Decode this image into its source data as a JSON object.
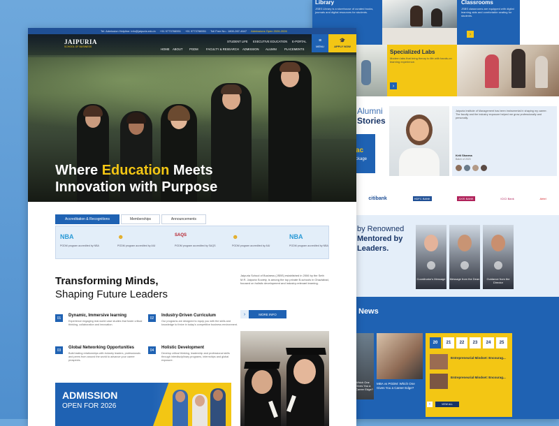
{
  "right": {
    "library": {
      "title": "Library",
      "text": "JSBS Library is a storehouse of curated books, journals and digital resources for students."
    },
    "classrooms": {
      "title": "Classrooms",
      "text": "JSBS classrooms are equipped with digital learning aids and comfortable seating for students."
    },
    "labs": {
      "title": "Specialized Labs",
      "text": "Modern labs that bring theory to life with hands-on learning experience."
    },
    "alumni": {
      "heading1": "Alumni",
      "heading2": "Stories",
      "card_partial": "ac",
      "card_partial2": "ckage",
      "quote": "Jaipuria Institute of Management has been instrumental in shaping my career. The faculty and the industry exposure helped me grow professionally and personally.",
      "name": "Kriti Sharma",
      "role": "Batch of 2023"
    },
    "recruiters": [
      "citibank",
      "HDFC BANK",
      "AXIS BANK",
      "ICICI Bank",
      "Airtel"
    ],
    "mentored": {
      "l1": "by Renowned",
      "l2": "Mentored by",
      "l3": "Leaders.",
      "p1": {
        "caption": "Coordinator's Message"
      },
      "p2": {
        "caption": "Message from the Dean"
      },
      "p3": {
        "caption": "Guidance from the Director"
      }
    },
    "news": {
      "heading": "News",
      "n1": "MBA vs PGDM: Which One Gives You a Career Edge?",
      "n0": "Which One Gives You a Career Edge?",
      "dates": [
        "20",
        "21",
        "22",
        "23",
        "24",
        "25"
      ],
      "month": "May",
      "items": [
        "Entrepreneurial Mindset: Encourag...",
        "Entrepreneurial Mindset: Encourag..."
      ],
      "view_all": "VIEW ALL"
    }
  },
  "left": {
    "topbar": [
      "Tel: Admission Helpline: info@jaipuria.edu.in",
      "+91 9773766551",
      "+91 9773766551",
      "Toll Free No.: 1800-267-4647",
      "Admissions Open 2026-2026"
    ],
    "brand": {
      "name": "JAIPURIA",
      "sub": "SCHOOL OF BUSINESS"
    },
    "utility_nav": [
      "STUDENT LIFE",
      "EXECUTIVE EDUCATION",
      "E-PORTAL"
    ],
    "main_nav": [
      "HOME",
      "ABOUT",
      "PGDM",
      "FACULTY & RESEARCH",
      "ADMISSION",
      "ALUMNI",
      "PLACEMENTS"
    ],
    "menu_label": "MENU",
    "apply_label": "APPLY NOW",
    "hero": {
      "title_before": "Where ",
      "title_highlight": "Education",
      "title_after": " Meets",
      "title_line2": "Innovation with Purpose"
    },
    "tabs": [
      "Accreditation & Recognitions",
      "Memberships",
      "Announcements"
    ],
    "accreditations": [
      {
        "logo": "NBA",
        "text": "PGDM program accredited by NBA"
      },
      {
        "logo": "☻",
        "text": "PGDM program accredited by AIU"
      },
      {
        "logo": "SAQS",
        "text": "PGDM program accredited by SAQS"
      },
      {
        "logo": "☻",
        "text": "PGDM program accredited by AIU"
      },
      {
        "logo": "NBA",
        "text": "PGDM program accredited by NBA"
      }
    ],
    "transform": {
      "l1": "Transforming Minds,",
      "l2": "Shaping Future Leaders",
      "about": "Jaipuria School of Business (JSBS) established in 2006 by the Seth M.R. Jaipuria Society, is among the top private B-schools in Ghaziabad, focused on holistic development and industry-relevant learning.",
      "more": "MORE INFO"
    },
    "features": [
      {
        "num": "01",
        "title": "Dynamic, Immersive learning",
        "text": "Experience engaging real-world case studies that foster critical thinking, collaboration and innovation."
      },
      {
        "num": "02",
        "title": "Industry-Driven Curriculum",
        "text": "Our programs are designed to equip you with the skills and knowledge to thrive in today's competitive business environment."
      },
      {
        "num": "03",
        "title": "Global Networking Opportunities",
        "text": "Build lasting relationships with industry leaders, professionals and peers from around the world to advance your career prospects."
      },
      {
        "num": "04",
        "title": "Holistic Development",
        "text": "Develop critical thinking, leadership and professional skills through interdisciplinary programs, internships and global exposure."
      }
    ],
    "admission": {
      "title": "ADMISSION",
      "sub": "OPEN FOR 2026"
    }
  }
}
